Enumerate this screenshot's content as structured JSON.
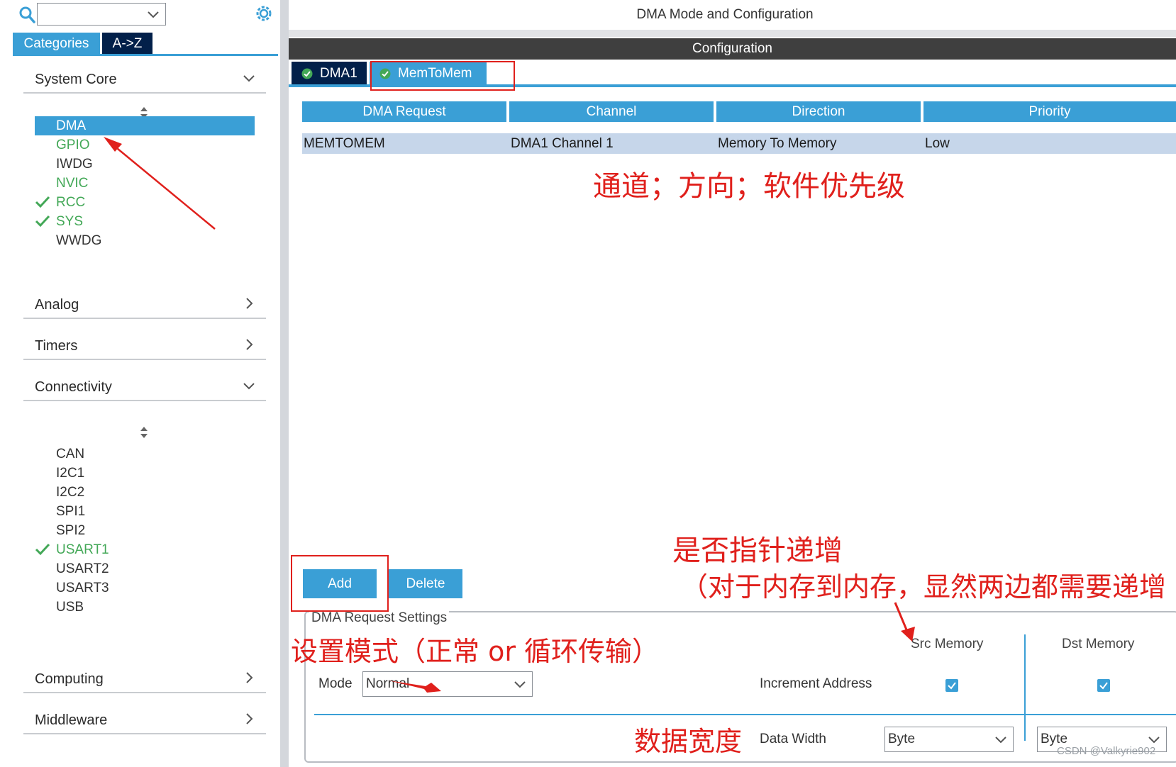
{
  "colors": {
    "accent": "#3a9fd6",
    "navy": "#02204a",
    "green": "#43a857",
    "annotation_red": "#e0201c",
    "row_selected": "#c6d6ea"
  },
  "left_panel": {
    "search": {
      "value": ""
    },
    "tabs": [
      {
        "label": "Categories",
        "active": true
      },
      {
        "label": "A->Z",
        "active": false
      }
    ],
    "groups": {
      "system_core": {
        "label": "System Core",
        "expanded": true,
        "items": [
          {
            "label": "DMA",
            "selected": true,
            "checked": false,
            "color": "#ffffff"
          },
          {
            "label": "GPIO",
            "selected": false,
            "checked": false,
            "color": "#43a857"
          },
          {
            "label": "IWDG",
            "selected": false,
            "checked": false,
            "color": "#333333"
          },
          {
            "label": "NVIC",
            "selected": false,
            "checked": false,
            "color": "#43a857"
          },
          {
            "label": "RCC",
            "selected": false,
            "checked": true,
            "color": "#43a857"
          },
          {
            "label": "SYS",
            "selected": false,
            "checked": true,
            "color": "#43a857"
          },
          {
            "label": "WWDG",
            "selected": false,
            "checked": false,
            "color": "#333333"
          }
        ]
      },
      "analog": {
        "label": "Analog",
        "expanded": false
      },
      "timers": {
        "label": "Timers",
        "expanded": false
      },
      "connectivity": {
        "label": "Connectivity",
        "expanded": true,
        "items": [
          {
            "label": "CAN",
            "checked": false,
            "color": "#333333"
          },
          {
            "label": "I2C1",
            "checked": false,
            "color": "#333333"
          },
          {
            "label": "I2C2",
            "checked": false,
            "color": "#333333"
          },
          {
            "label": "SPI1",
            "checked": false,
            "color": "#333333"
          },
          {
            "label": "SPI2",
            "checked": false,
            "color": "#333333"
          },
          {
            "label": "USART1",
            "checked": true,
            "color": "#43a857"
          },
          {
            "label": "USART2",
            "checked": false,
            "color": "#333333"
          },
          {
            "label": "USART3",
            "checked": false,
            "color": "#333333"
          },
          {
            "label": "USB",
            "checked": false,
            "color": "#333333"
          }
        ]
      },
      "computing": {
        "label": "Computing",
        "expanded": false
      },
      "middleware": {
        "label": "Middleware",
        "expanded": false
      }
    }
  },
  "main": {
    "title": "DMA Mode and Configuration",
    "configuration_header": "Configuration",
    "tabs": [
      {
        "label": "DMA1",
        "active": false
      },
      {
        "label": "MemToMem",
        "active": true
      }
    ],
    "table": {
      "headers": [
        "DMA Request",
        "Channel",
        "Direction",
        "Priority"
      ],
      "rows": [
        [
          "MEMTOMEM",
          "DMA1 Channel 1",
          "Memory To Memory",
          "Low"
        ]
      ]
    },
    "buttons": {
      "add": "Add",
      "delete": "Delete"
    },
    "settings": {
      "legend": "DMA Request Settings",
      "mode_label": "Mode",
      "mode_value": "Normal",
      "src_header": "Src Memory",
      "dst_header": "Dst Memory",
      "increment_label": "Increment Address",
      "src_increment_checked": true,
      "dst_increment_checked": true,
      "data_width_label": "Data Width",
      "src_data_width": "Byte",
      "dst_data_width": "Byte"
    }
  },
  "annotations": {
    "table_note": "通道；方向；软件优先级",
    "increment_note_line1": "是否指针递增",
    "increment_note_line2": "（对于内存到内存，显然两边都需要递增",
    "mode_note": "设置模式（正常 or 循环传输）",
    "width_note": "数据宽度"
  },
  "watermark": "CSDN @Valkyrie902"
}
